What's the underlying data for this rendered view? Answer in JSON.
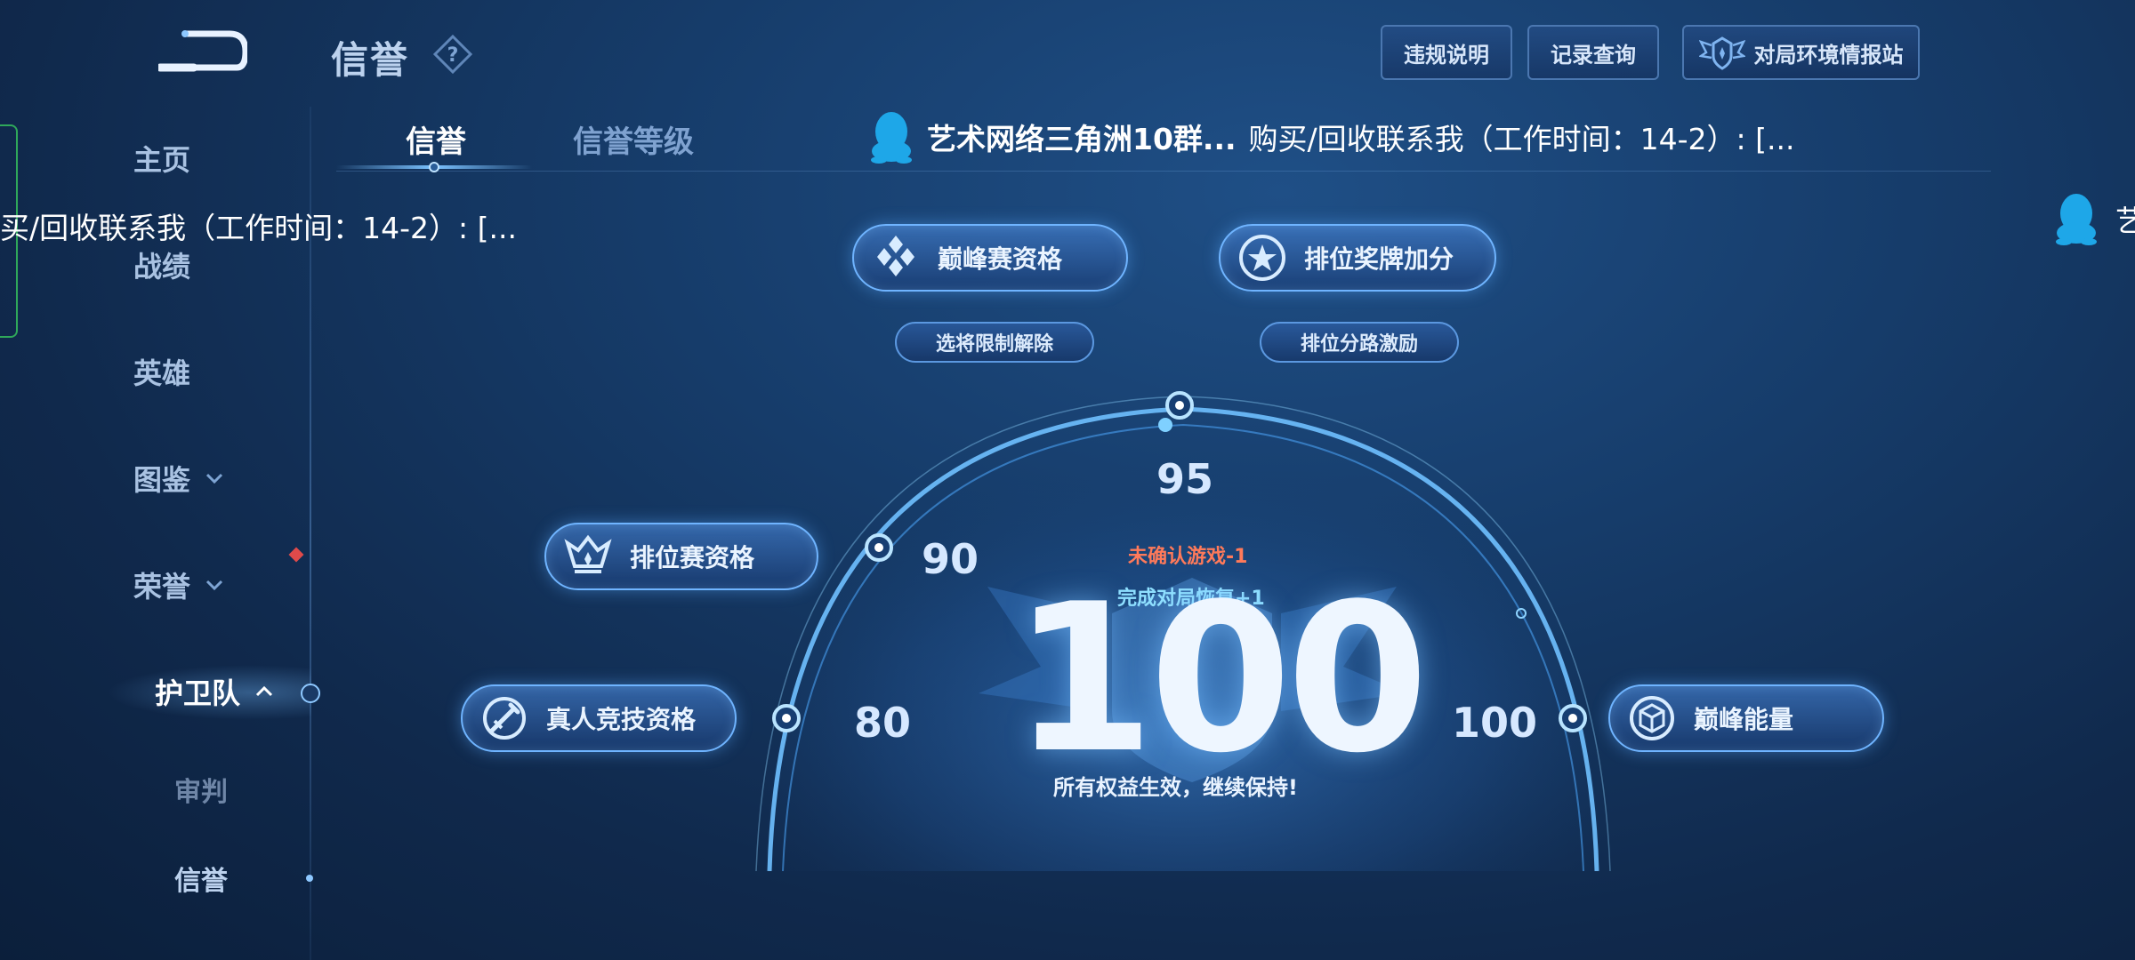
{
  "header": {
    "title": "信誉",
    "help_icon": "question-icon"
  },
  "top_buttons": {
    "rules": "违规说明",
    "records": "记录查询",
    "station": "对局环境情报站"
  },
  "sidebar": {
    "items": [
      {
        "label": "主页"
      },
      {
        "label": "战绩"
      },
      {
        "label": "英雄"
      },
      {
        "label": "图鉴"
      },
      {
        "label": "荣誉"
      },
      {
        "label": "护卫队"
      },
      {
        "label": "审判"
      },
      {
        "label": "信誉"
      }
    ]
  },
  "tabs": {
    "credit": "信誉",
    "level": "信誉等级"
  },
  "notice": {
    "group": "艺术网络三角洲10群...",
    "message": "购买/回收联系我（工作时间：14-2）: [...",
    "line2": "买/回收联系我（工作时间：14-2）: [...",
    "right_fragment": "艺"
  },
  "benefits": {
    "peak_qualification": "巅峰赛资格",
    "hero_restriction": "选将限制解除",
    "rank_medal": "排位奖牌加分",
    "rank_lane": "排位分路激励",
    "ranked_qualification": "排位赛资格",
    "real_competitive": "真人竞技资格",
    "peak_energy": "巅峰能量"
  },
  "gauge": {
    "ticks": [
      "80",
      "90",
      "95",
      "100"
    ],
    "score": "100",
    "unconfirmed": "未确认游戏-1",
    "recovery": "完成对局恢复+1",
    "status": "所有权益生效，继续保持!"
  },
  "colors": {
    "accent": "#6fb4ff",
    "negative": "#ff7a5a",
    "positive": "#8fe0ff",
    "notification": "#e04a4a"
  }
}
